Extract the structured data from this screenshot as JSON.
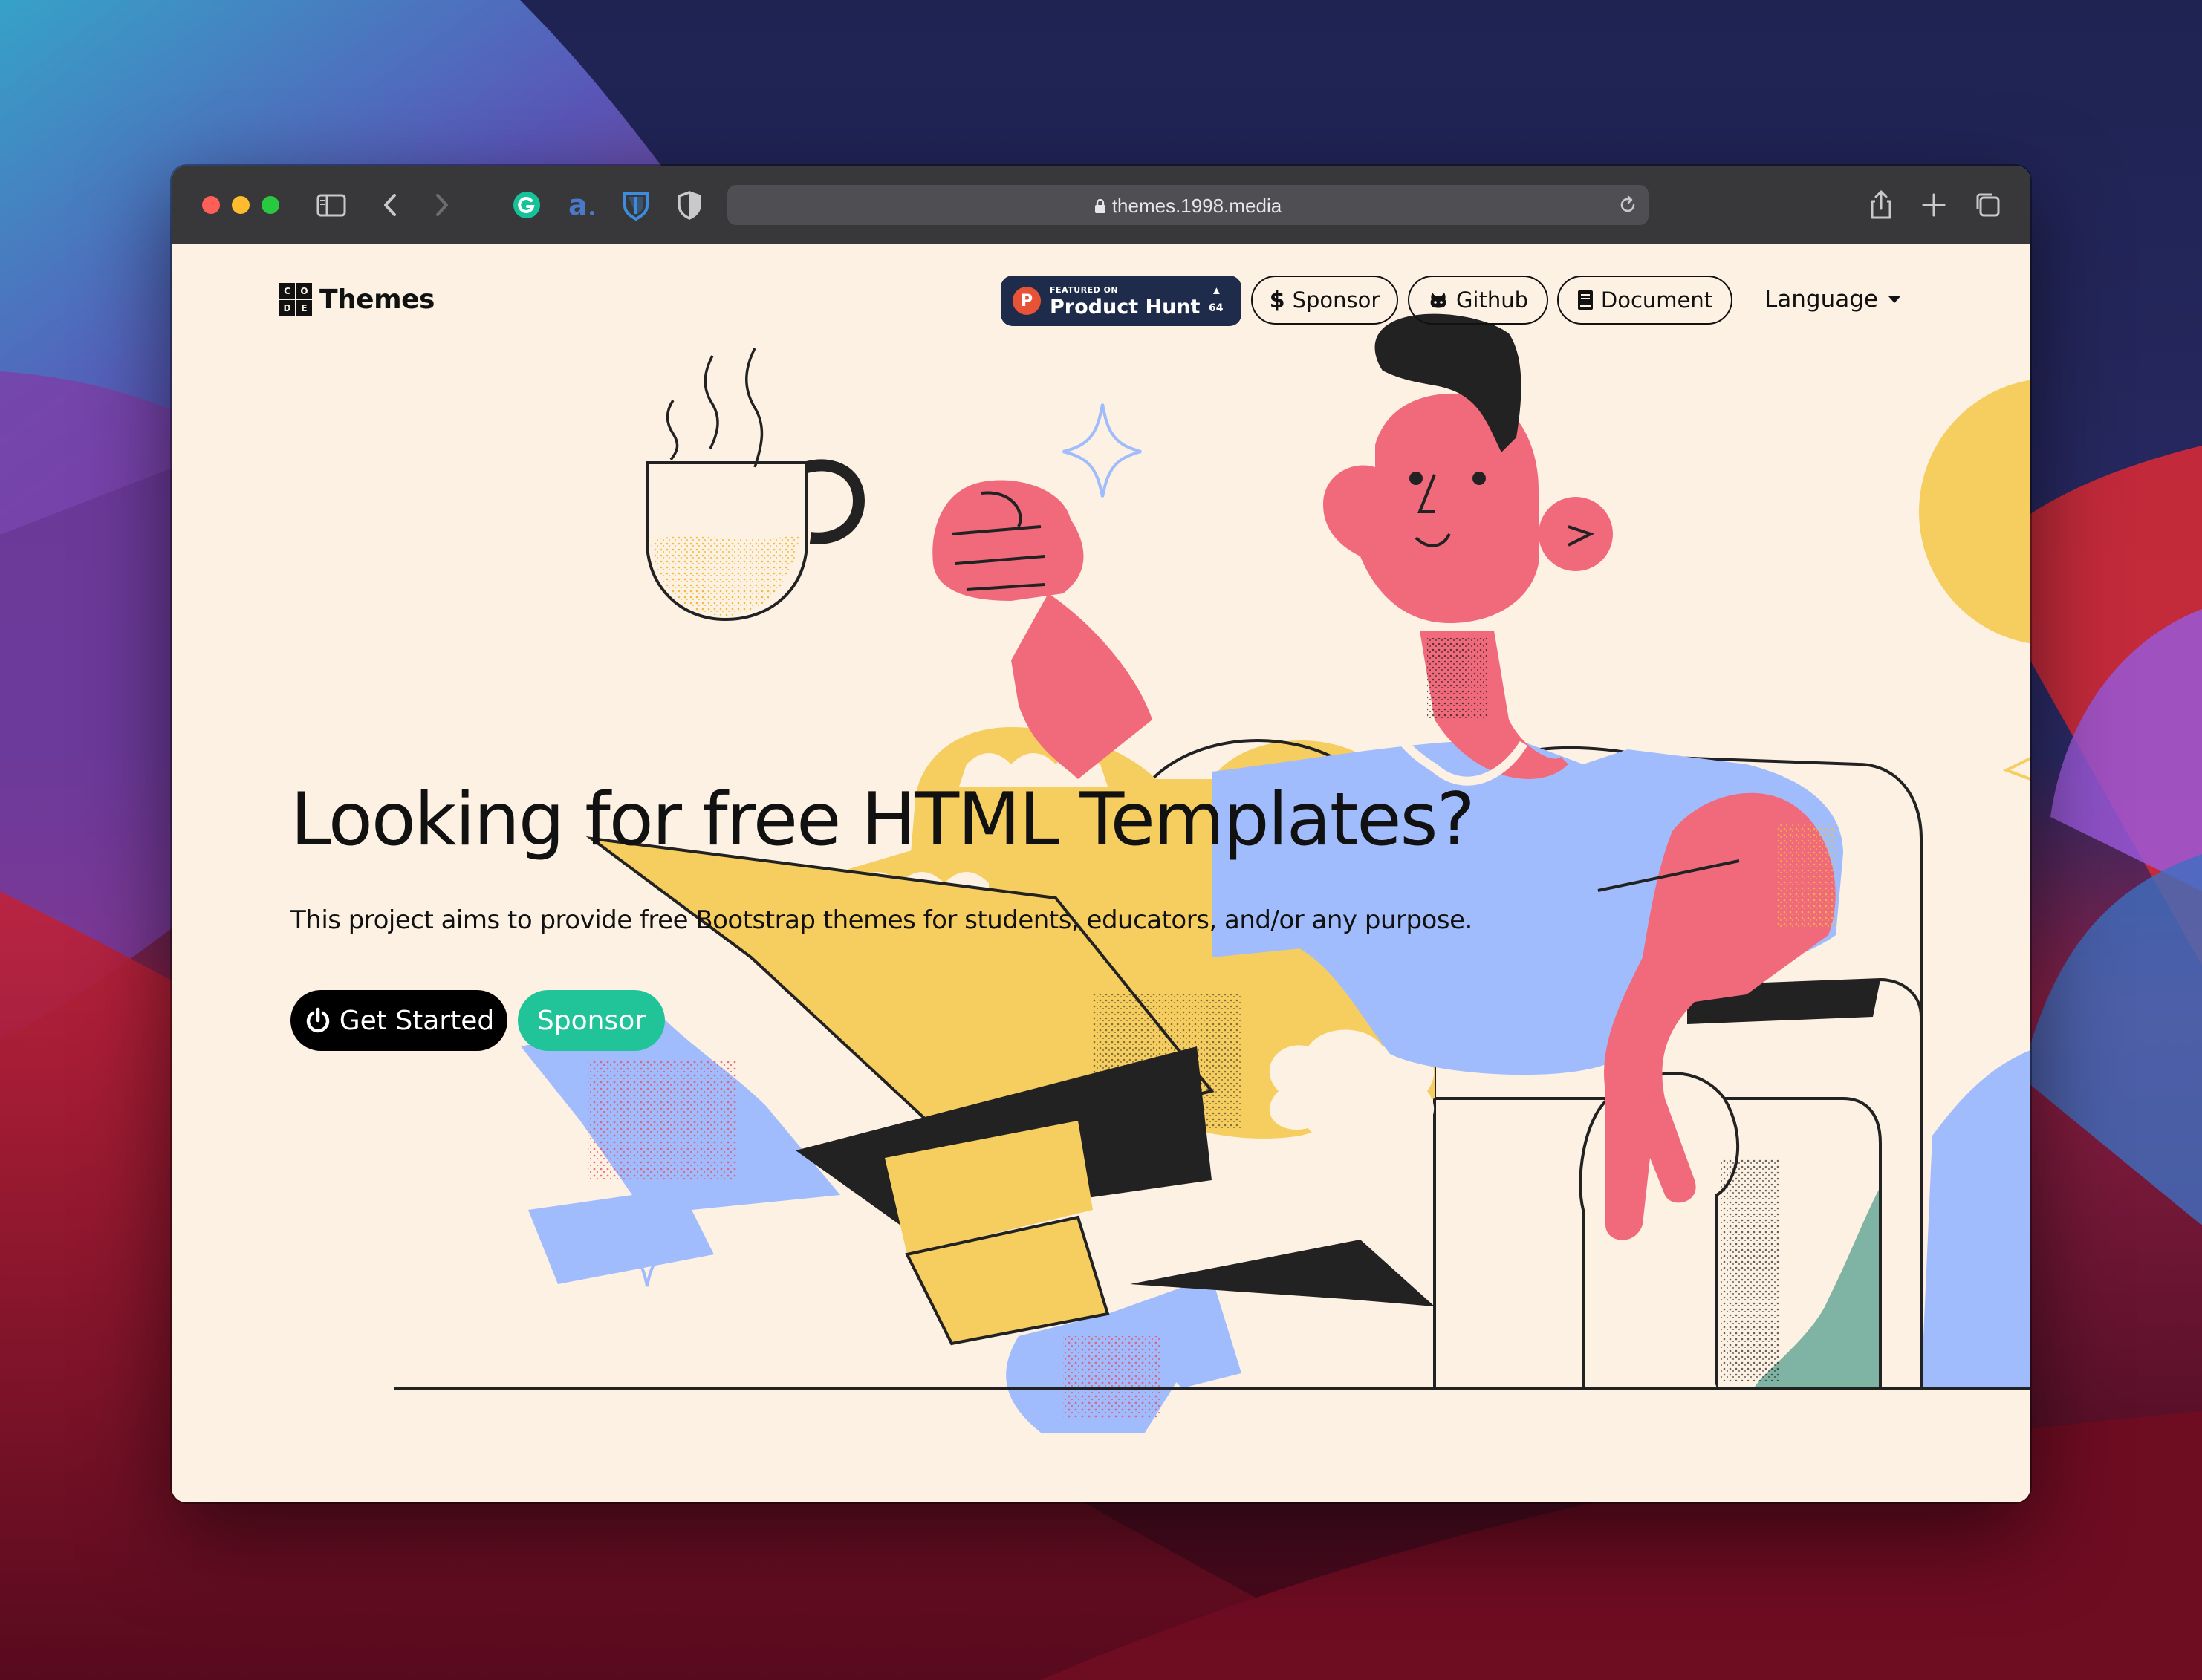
{
  "browser": {
    "url": "themes.1998.media",
    "colors": {
      "close": "#ff5f57",
      "minimize": "#febc2e",
      "zoom": "#28c840"
    },
    "extensions": [
      "grammarly-icon",
      "amazon-assistant-icon",
      "bitwarden-icon",
      "privacy-shield-icon"
    ]
  },
  "nav": {
    "brand_logo_letters": [
      "C",
      "O",
      "D",
      "E"
    ],
    "brand_name": "Themes",
    "product_hunt": {
      "small": "FEATURED ON",
      "big": "Product Hunt",
      "count": "64"
    },
    "sponsor": "Sponsor",
    "github": "Github",
    "document": "Document",
    "language": "Language"
  },
  "hero": {
    "title": "Looking for free HTML Templates?",
    "subtitle": "This project aims to provide free Bootstrap themes for students, educators, and/or any purpose.",
    "get_started": "Get Started",
    "sponsor": "Sponsor"
  },
  "colors": {
    "page_bg": "#fdf1e4",
    "pink": "#f16a7c",
    "yellow": "#f6cd5f",
    "blue": "#a1bcfc",
    "green": "#7fb4a4",
    "accent_green": "#21c499"
  }
}
